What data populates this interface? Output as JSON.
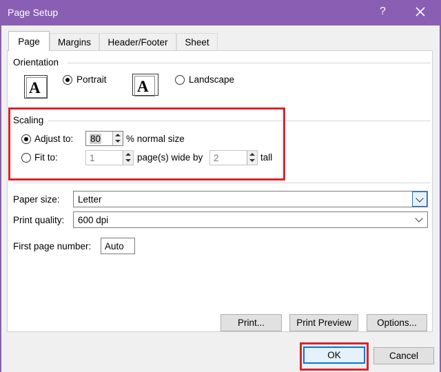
{
  "window": {
    "title": "Page Setup",
    "help": "?",
    "close_icon": "close-icon"
  },
  "tabs": [
    {
      "label": "Page",
      "active": true
    },
    {
      "label": "Margins",
      "active": false
    },
    {
      "label": "Header/Footer",
      "active": false
    },
    {
      "label": "Sheet",
      "active": false
    }
  ],
  "orientation": {
    "label": "Orientation",
    "portrait": {
      "label": "Portrait",
      "checked": true,
      "icon_letter": "A"
    },
    "landscape": {
      "label": "Landscape",
      "checked": false,
      "icon_letter": "A"
    }
  },
  "scaling": {
    "label": "Scaling",
    "adjust_to": {
      "label": "Adjust to:",
      "checked": true,
      "value": "80",
      "suffix": "% normal size"
    },
    "fit_to": {
      "label": "Fit to:",
      "checked": false,
      "wide_value": "1",
      "wide_suffix": "page(s) wide by",
      "tall_value": "2",
      "tall_suffix": "tall"
    }
  },
  "paper_size": {
    "label": "Paper size:",
    "value": "Letter"
  },
  "print_quality": {
    "label": "Print quality:",
    "value": "600 dpi"
  },
  "first_page_number": {
    "label": "First page number:",
    "value": "Auto"
  },
  "buttons": {
    "print": "Print...",
    "print_preview": "Print Preview",
    "options": "Options...",
    "ok": "OK",
    "cancel": "Cancel"
  },
  "colors": {
    "titlebar": "#8a5fb3",
    "highlight": "#d9232e",
    "focus": "#0078d7"
  }
}
